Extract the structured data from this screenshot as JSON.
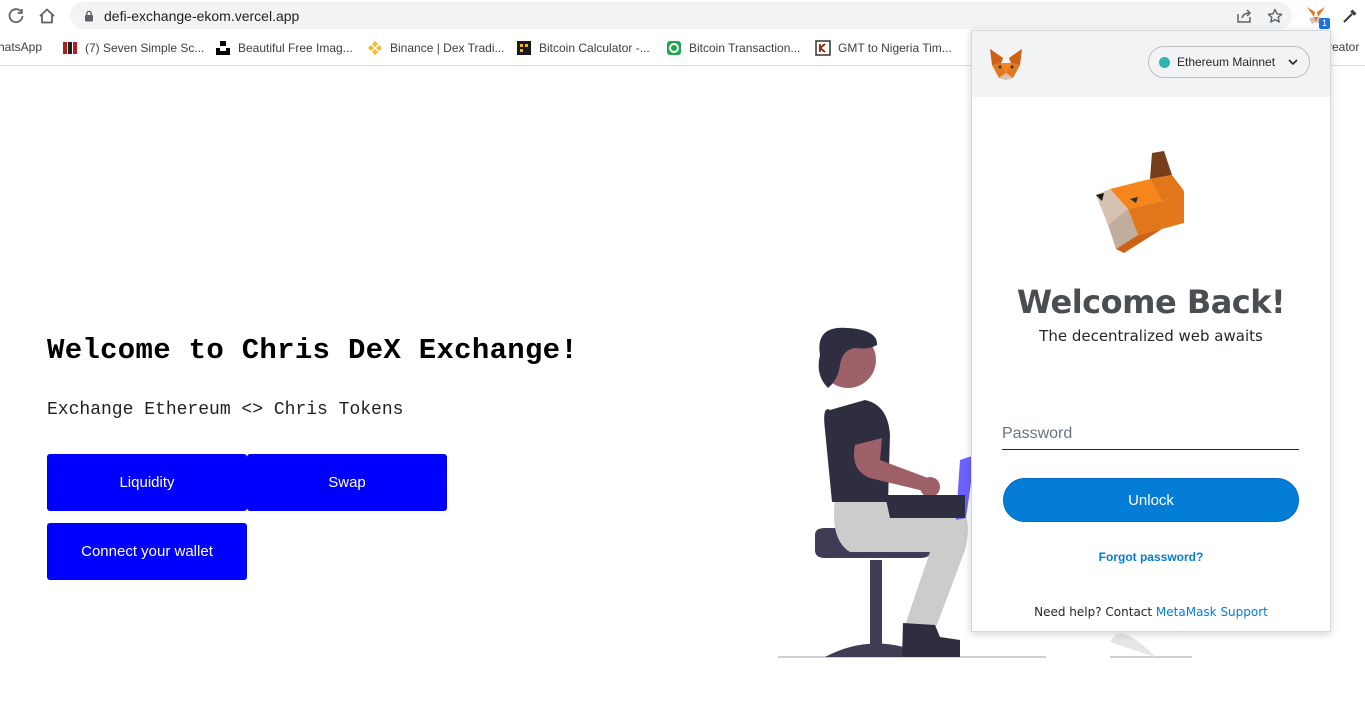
{
  "browser": {
    "url": "defi-exchange-ekom.vercel.app",
    "extension_badge": "1",
    "bookmarks": [
      {
        "label": "hatsApp",
        "icon": "whatsapp-icon"
      },
      {
        "label": "(7) Seven Simple Sc...",
        "icon": "medium-icon"
      },
      {
        "label": "Beautiful Free Imag...",
        "icon": "unsplash-icon"
      },
      {
        "label": "Binance | Dex Tradi...",
        "icon": "binance-icon"
      },
      {
        "label": "Bitcoin Calculator -...",
        "icon": "calculator-icon"
      },
      {
        "label": "Bitcoin Transaction...",
        "icon": "blockchain-icon"
      },
      {
        "label": "GMT to Nigeria Tim...",
        "icon": "time-icon"
      },
      {
        "label": "reator",
        "icon": "page-icon"
      }
    ]
  },
  "page": {
    "title": "Welcome to Chris DeX Exchange!",
    "subtitle": "Exchange Ethereum <> Chris Tokens",
    "buttons": {
      "liquidity": "Liquidity",
      "swap": "Swap",
      "connect": "Connect your wallet"
    },
    "accent_color": "#0000ff"
  },
  "metamask": {
    "network": "Ethereum Mainnet",
    "title": "Welcome Back!",
    "subtitle": "The decentralized web awaits",
    "password_placeholder": "Password",
    "unlock_label": "Unlock",
    "forgot_label": "Forgot password?",
    "help_text": "Need help? Contact",
    "help_link": "MetaMask Support",
    "accent_color": "#037dd6"
  }
}
